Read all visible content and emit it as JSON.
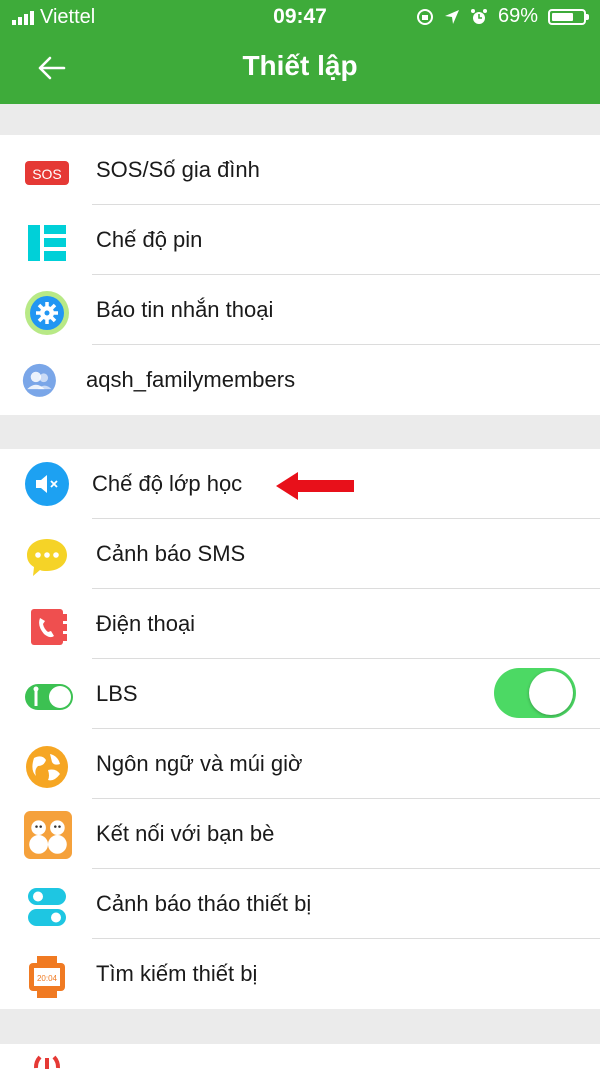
{
  "status_bar": {
    "carrier": "Viettel",
    "time": "09:47",
    "battery": "69%",
    "battery_level": 0.69
  },
  "header": {
    "title": "Thiết lập"
  },
  "group1": [
    {
      "label": "SOS/Số gia đình",
      "icon": "sos-icon",
      "icon_text": "SOS",
      "color": "#e53935"
    },
    {
      "label": "Chế độ pin",
      "icon": "battery-mode-icon",
      "color": "#00d0d8"
    },
    {
      "label": "Báo tin nhắn thoại",
      "icon": "gear-icon",
      "color": "#2196f3"
    },
    {
      "label": "aqsh_familymembers",
      "icon": "family-members-icon",
      "color": "#7aa6e8"
    }
  ],
  "group2": [
    {
      "label": "Chế độ lớp học",
      "icon": "class-mode-icon",
      "color": "#1da1f2"
    },
    {
      "label": "Cảnh báo SMS",
      "icon": "sms-alert-icon",
      "color": "#f5d327"
    },
    {
      "label": "Điện thoại",
      "icon": "phone-book-icon",
      "color": "#ef4f4f"
    },
    {
      "label": "LBS",
      "icon": "lbs-toggle-icon",
      "color": "#3cc152",
      "toggle_on": true
    },
    {
      "label": "Ngôn ngữ và múi giờ",
      "icon": "globe-icon",
      "color": "#f6a623"
    },
    {
      "label": "Kết nối với bạn bè",
      "icon": "friends-icon",
      "color": "#f5a13b"
    },
    {
      "label": "Cảnh báo tháo thiết bị",
      "icon": "device-removal-icon",
      "color": "#1ec6e2"
    },
    {
      "label": "Tìm kiếm thiết bị",
      "icon": "watch-icon",
      "icon_text": "20:04",
      "color": "#f07a22"
    }
  ],
  "accent": "#3eab3a",
  "annotation_color": "#e8101a"
}
